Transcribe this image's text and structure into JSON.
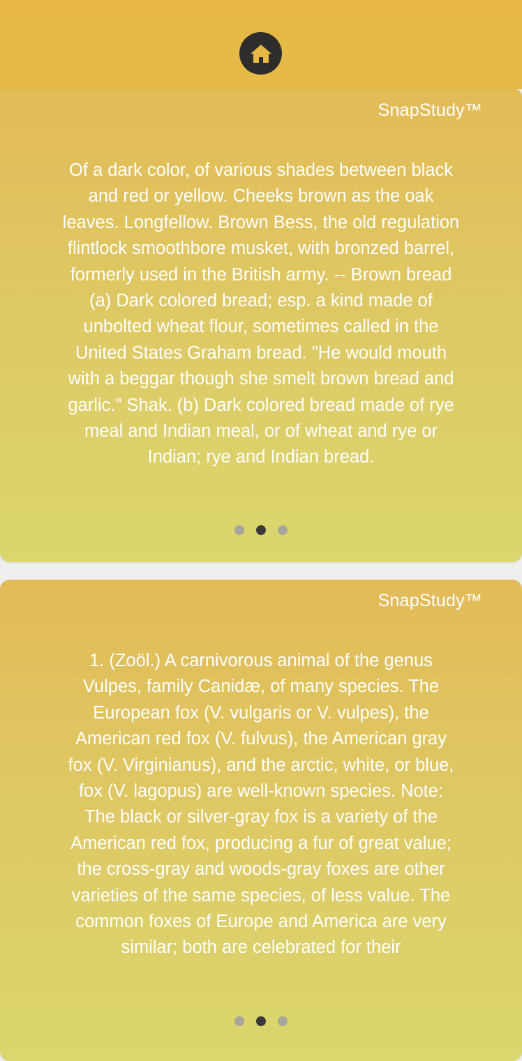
{
  "header": {
    "home_icon": "home-icon",
    "color": "#e5b845"
  },
  "cards": [
    {
      "brand": "SnapStudy™",
      "text": "Of a dark color, of various shades between black and red or yellow. Cheeks brown as the oak leaves. Longfellow. Brown Bess, the old regulation flintlock smoothbore musket, with bronzed barrel, formerly used in the British army. -- Brown bread (a) Dark colored bread; esp. a kind made of unbolted wheat flour, sometimes called in the United States Graham bread. \"He would mouth with a beggar though she smelt brown bread and garlic.\" Shak. (b) Dark colored bread made of rye meal and Indian meal, or of wheat and rye or Indian; rye and Indian bread.",
      "pager": {
        "pages": 3,
        "active": 2
      }
    },
    {
      "brand": "SnapStudy™",
      "text": "1. (Zoöl.)  A carnivorous animal of the genus Vulpes, family Canidæ, of many species. The European fox (V. vulgaris or V. vulpes), the American red fox (V. fulvus), the American gray fox (V. Virginianus), and the arctic, white, or blue, fox (V. lagopus) are well-known species. Note: The black or silver-gray fox is a variety of the American red fox, producing a fur of great value; the cross-gray and woods-gray foxes are other varieties of the same species, of less value. The common foxes of Europe and America are very similar; both are celebrated for their",
      "pager": {
        "pages": 3,
        "active": 2
      }
    }
  ],
  "colors": {
    "card_gradient_top": "#e2bb57",
    "card_gradient_bottom": "#dbd66e",
    "dot_inactive": "#a6a59a",
    "dot_active": "#3a3935"
  }
}
